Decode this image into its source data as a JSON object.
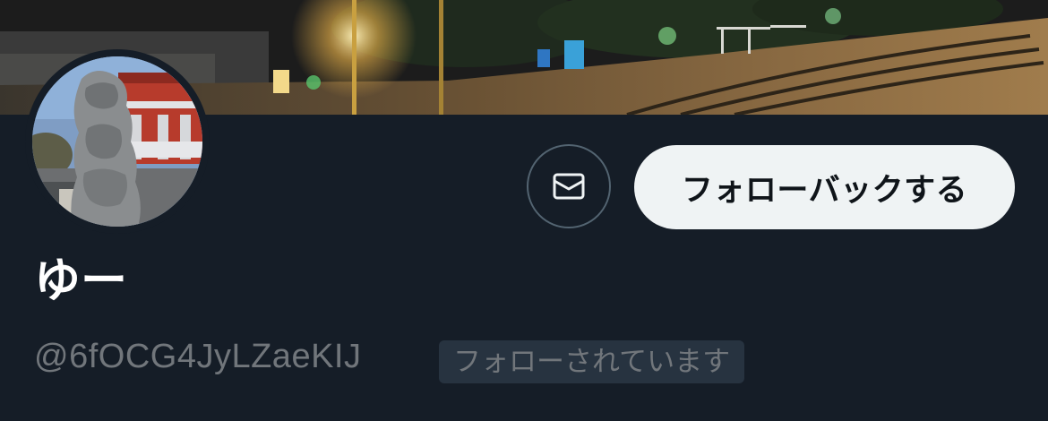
{
  "profile": {
    "display_name": "ゆー",
    "handle": "@6fOCG4JyLZaeKIJ",
    "follows_you_label": "フォローされています"
  },
  "actions": {
    "follow_back_label": "フォローバックする",
    "message_icon": "envelope-icon"
  },
  "theme": {
    "background": "#151d27",
    "button_fill": "#eff3f4",
    "button_text": "#0f1419",
    "muted_text": "#71767b",
    "badge_bg": "#273340",
    "outline": "#536471"
  }
}
